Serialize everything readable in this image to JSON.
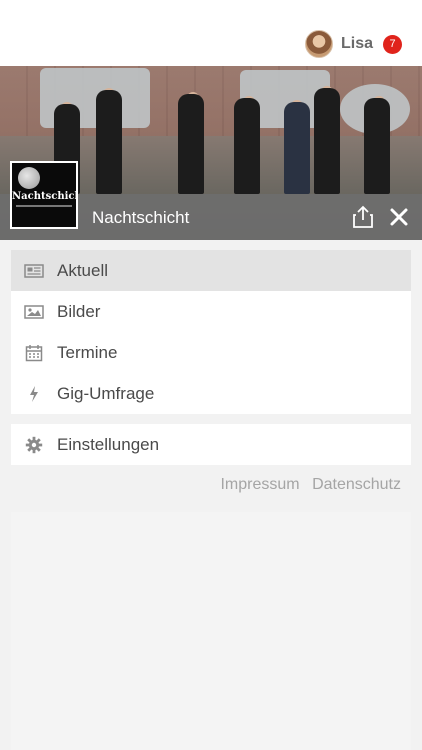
{
  "user": {
    "name": "Lisa",
    "notification_count": "7",
    "avatar_icon": "user-avatar"
  },
  "band": {
    "name": "Nachtschicht",
    "logo_text": "Nachtschicht",
    "share_icon": "share-icon",
    "close_icon": "close-icon"
  },
  "menu": {
    "items": [
      {
        "label": "Aktuell",
        "icon": "newspaper-icon",
        "active": true
      },
      {
        "label": "Bilder",
        "icon": "image-icon",
        "active": false
      },
      {
        "label": "Termine",
        "icon": "calendar-icon",
        "active": false
      },
      {
        "label": "Gig-Umfrage",
        "icon": "lightning-icon",
        "active": false
      }
    ],
    "settings": {
      "label": "Einstellungen",
      "icon": "gear-icon"
    }
  },
  "footer": {
    "impressum": "Impressum",
    "datenschutz": "Datenschutz"
  },
  "colors": {
    "badge": "#e0231b",
    "active_row": "#e3e3e3",
    "bar": "#6e6e6e"
  }
}
